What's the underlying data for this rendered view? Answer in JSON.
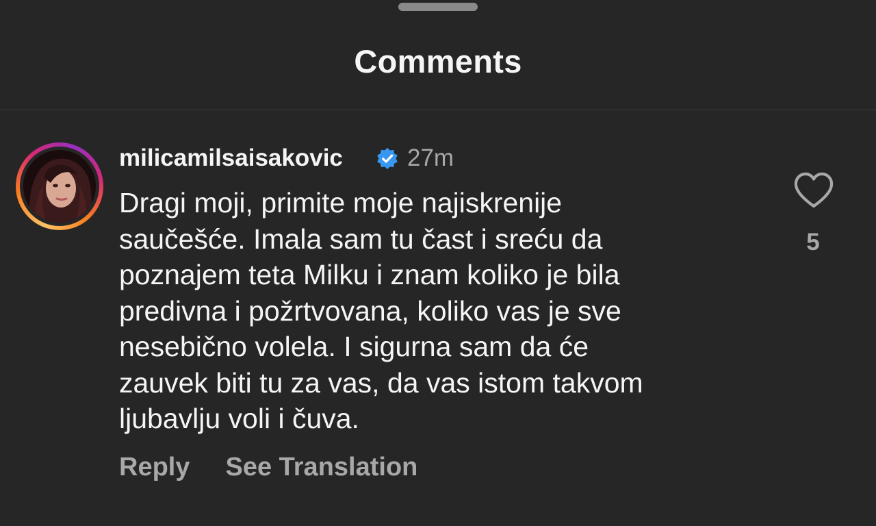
{
  "header": {
    "title": "Comments"
  },
  "comment": {
    "avatar_icon": "user-avatar",
    "username": "milicamilsaisakovic",
    "verified_icon": "verified-badge-icon",
    "verified_color": "#3897f0",
    "timestamp": "27m",
    "text_lines": [
      "Dragi moji, primite moje najiskrenije",
      "saučešće. Imala sam tu čast i sreću da",
      "poznajem teta Milku i znam koliko je bila",
      "predivna i požrtvovana, koliko vas je sve",
      "nesebično volela. I sigurna sam da će",
      "zauvek biti tu za vas, da vas istom takvom",
      "ljubavlju voli i čuva."
    ],
    "like_icon": "heart-outline-icon",
    "like_count": "5",
    "actions": {
      "reply": "Reply",
      "see_translation": "See Translation"
    }
  },
  "colors": {
    "background": "#262626",
    "primary_text": "#f5f5f5",
    "secondary_text": "#a8a8a8"
  }
}
